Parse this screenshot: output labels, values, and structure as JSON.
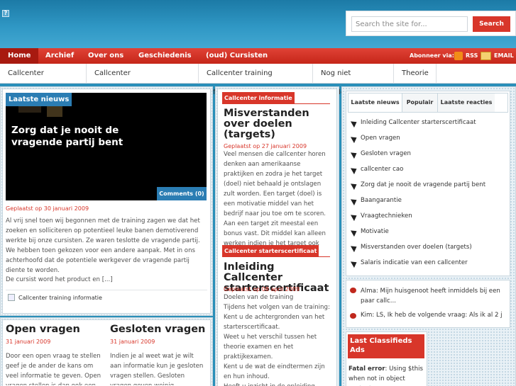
{
  "header": {
    "search": {
      "placeholder": "Search the site for...",
      "button": "Search"
    }
  },
  "nav": {
    "items": [
      "Home",
      "Archief",
      "Over ons",
      "Geschiedenis",
      "(oud) Cursisten"
    ],
    "subscribe_label": "Abonneer via:",
    "rss": "RSS",
    "email": "EMAIL"
  },
  "categories": [
    "Callcenter informatie",
    "Callcenter starterscertificaat",
    "Callcenter training informatie",
    "Nog niet ingedeeld",
    "Theorie"
  ],
  "featured": {
    "label": "Laatste nieuws",
    "title": "Zorg dat je nooit de vragende partij bent",
    "comments": "Comments (0)",
    "meta": "Geplaatst op 30 januari 2009",
    "body": "Al vrij snel toen wij begonnen met de training zagen we dat het zoeken en solliciteren op potentieel leuke banen demotiverend werkte bij onze cursisten. Ze waren teslotte de vragende partij. We hebben toen gekozen voor een andere aanpak. Met in ons achterhoofd dat de potentiele werkgever de vragende partij diente te worden.",
    "body2": "De cursist word het product en [...]",
    "category": "Callcenter training informatie"
  },
  "small_posts": [
    {
      "title": "Open vragen",
      "meta": "31 januari 2009",
      "body": "Door een open vraag te stellen geef je de ander de kans om veel informatie te geven. Open vragen stellen is dan ook een"
    },
    {
      "title": "Gesloten vragen",
      "meta": "31 januari 2009",
      "body": "Indien je al weet wat je wilt aan informatie kun je gesloten vragen stellen. Gesloten vragen geven weinig"
    }
  ],
  "middle": [
    {
      "tag": "Callcenter informatie",
      "title": "Misverstanden over doelen (targets)",
      "meta": "Geplaatst op 27 januari 2009",
      "body": "Veel mensen die callcenter horen denken aan amerikaanse praktijken en zodra je het target (doel) niet behaald je ontslagen zult worden. Een target (doel) is een motivatie middel van het bedrijf naar jou toe om te scoren. Aan een target zit meestal een bonus vast. Dit middel kan alleen werken indien je het target ook kunt behalen. [...]"
    },
    {
      "tag": "Callcenter starterscertificaat",
      "title": "Inleiding Callcenter starterscertificaat",
      "meta": "Geplaatst op 08 april 2009",
      "body": "Doelen van de training\nTijdens het volgen van de training:\nKent u de achtergronden van het starterscertificaat.\nWeet u het verschil tussen het theorie examen en het praktijkexamen.\nKent u de wat de eindtermen zijn en hun inhoud.\nHeeft u inzicht in de opleiding"
    }
  ],
  "sidebar": {
    "tabs": [
      "Laatste nieuws",
      "Populair",
      "Laatste reacties"
    ],
    "items": [
      "Inleiding Callcenter starterscertificaat",
      "Open vragen",
      "Gesloten vragen",
      "callcenter cao",
      "Zorg dat je nooit de vragende partij bent",
      "Baangarantie",
      "Vraagtechnieken",
      "Motivatie",
      "Misverstanden over doelen (targets)",
      "Salaris indicatie van een callcenter"
    ],
    "comments": [
      "Alma: Mijn huisgenoot heeft inmiddels bij een paar callc...",
      "Kim: LS, Ik heb de volgende vraag: Als ik al 2 ja..."
    ],
    "classifieds_title": "Last Classifieds Ads",
    "error_label": "Fatal error",
    "error_text": ": Using $this when not in object context"
  }
}
